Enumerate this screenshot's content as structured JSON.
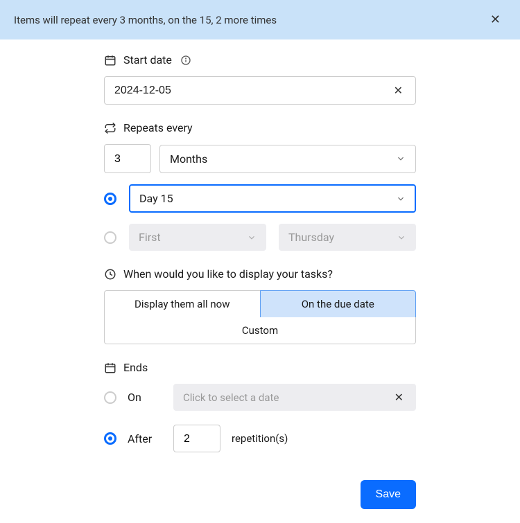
{
  "banner": {
    "text": "Items will repeat every 3 months, on the 15, 2 more times",
    "close": "✕"
  },
  "start_date": {
    "label": "Start date",
    "value": "2024-12-05",
    "clear": "✕"
  },
  "repeats": {
    "label": "Repeats every",
    "interval": "3",
    "unit": "Months",
    "day_option": {
      "selected": true,
      "label": "Day 15"
    },
    "weekday_option": {
      "selected": false,
      "ordinal": "First",
      "weekday": "Thursday"
    }
  },
  "display": {
    "label": "When would you like to display your tasks?",
    "opt_all_now": "Display them all now",
    "opt_due": "On the due date",
    "opt_custom": "Custom",
    "selected": "opt_due"
  },
  "ends": {
    "label": "Ends",
    "on": {
      "selected": false,
      "label": "On",
      "placeholder": "Click to select a date",
      "clear": "✕"
    },
    "after": {
      "selected": true,
      "label": "After",
      "count": "2",
      "unit": "repetition(s)"
    }
  },
  "save_label": "Save"
}
